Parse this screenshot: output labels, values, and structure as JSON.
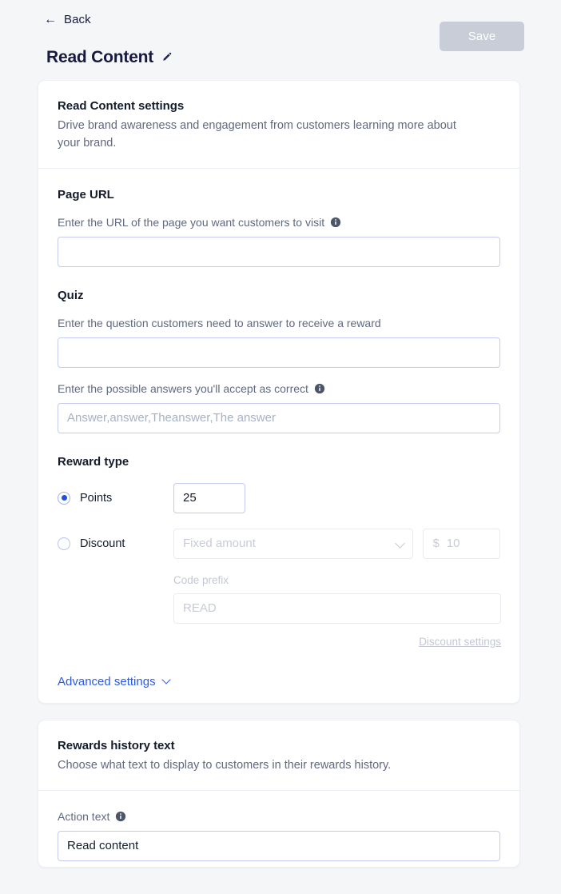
{
  "header": {
    "back_label": "Back",
    "back_icon": "arrow-left-icon",
    "title": "Read Content",
    "edit_icon": "pencil-icon",
    "save_label": "Save",
    "save_disabled": true
  },
  "settings_card": {
    "title": "Read Content settings",
    "subtitle": "Drive brand awareness and engagement from customers learning more about your brand.",
    "page_url": {
      "section_title": "Page URL",
      "label": "Enter the URL of the page you want customers to visit",
      "info_icon": "info-icon",
      "value": "",
      "placeholder": ""
    },
    "quiz": {
      "section_title": "Quiz",
      "question_label": "Enter the question customers need to answer to receive a reward",
      "question_value": "",
      "question_placeholder": "",
      "answers_label": "Enter the possible answers you'll accept as correct",
      "answers_info_icon": "info-icon",
      "answers_value": "",
      "answers_placeholder": "Answer,answer,Theanswer,The answer"
    },
    "reward_type": {
      "section_title": "Reward type",
      "selected": "points",
      "points": {
        "label": "Points",
        "value": "25"
      },
      "discount": {
        "label": "Discount",
        "type_placeholder": "Fixed amount",
        "type_value": "",
        "chevron_icon": "chevron-down-icon",
        "currency_symbol": "$",
        "amount_placeholder": "10",
        "amount_value": "",
        "code_prefix_label": "Code prefix",
        "code_prefix_placeholder": "READ",
        "code_prefix_value": "",
        "settings_link": "Discount settings"
      }
    },
    "advanced": {
      "label": "Advanced settings",
      "chevron_icon": "chevron-down-icon"
    }
  },
  "history_card": {
    "title": "Rewards history text",
    "subtitle": "Choose what text to display to customers in their rewards history.",
    "action_text": {
      "label": "Action text",
      "info_icon": "info-icon",
      "value": "Read content",
      "placeholder": ""
    }
  },
  "colors": {
    "page_bg": "#f4f6f8",
    "card_bg": "#ffffff",
    "accent_blue": "#2b59e8",
    "radio_blue": "#1b52e0",
    "title_dark": "#18193f",
    "muted_text": "#61697f",
    "disabled_text": "#c3c8d4",
    "input_border": "#c3ccf0",
    "save_disabled_bg": "#c8cdd7"
  }
}
